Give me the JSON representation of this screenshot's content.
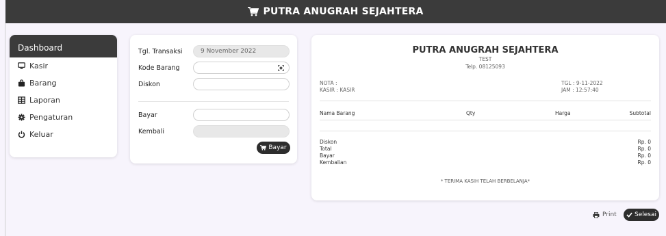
{
  "header": {
    "title": "PUTRA ANUGRAH SEJAHTERA"
  },
  "sidebar": {
    "heading": "Dashboard",
    "items": [
      {
        "label": "Kasir",
        "icon": "monitor-icon"
      },
      {
        "label": "Barang",
        "icon": "bag-icon"
      },
      {
        "label": "Laporan",
        "icon": "table-icon"
      },
      {
        "label": "Pengaturan",
        "icon": "gear-icon"
      },
      {
        "label": "Keluar",
        "icon": "power-icon"
      }
    ]
  },
  "form": {
    "tgl_label": "Tgl. Transaksi",
    "tgl_value": "9 November 2022",
    "kode_label": "Kode Barang",
    "kode_value": "",
    "diskon_label": "Diskon",
    "diskon_value": "",
    "bayar_label": "Bayar",
    "bayar_value": "",
    "kembali_label": "Kembali",
    "kembali_value": "",
    "submit_label": "Bayar"
  },
  "receipt": {
    "store_name": "PUTRA ANUGRAH SEJAHTERA",
    "sub": "TEST",
    "phone": "Telp. 08125093",
    "nota": "NOTA :",
    "kasir": "KASIR : KASIR",
    "tgl": "TGL : 9-11-2022",
    "jam": "JAM : 12:57:40",
    "columns": {
      "name": "Nama Barang",
      "qty": "Qty",
      "harga": "Harga",
      "subtotal": "Subtotal"
    },
    "totals": [
      {
        "label": "Diskon",
        "value": "Rp. 0"
      },
      {
        "label": "Total",
        "value": "Rp. 0"
      },
      {
        "label": "Bayar",
        "value": "Rp. 0"
      },
      {
        "label": "Kembalian",
        "value": "Rp. 0"
      }
    ],
    "thanks": "* TERIMA KASIH TELAH BERBELANJA*"
  },
  "actions": {
    "print_label": "Print",
    "done_label": "Selesai"
  },
  "colors": {
    "dark": "#3b3b3b",
    "bg": "#f7f4fc"
  }
}
